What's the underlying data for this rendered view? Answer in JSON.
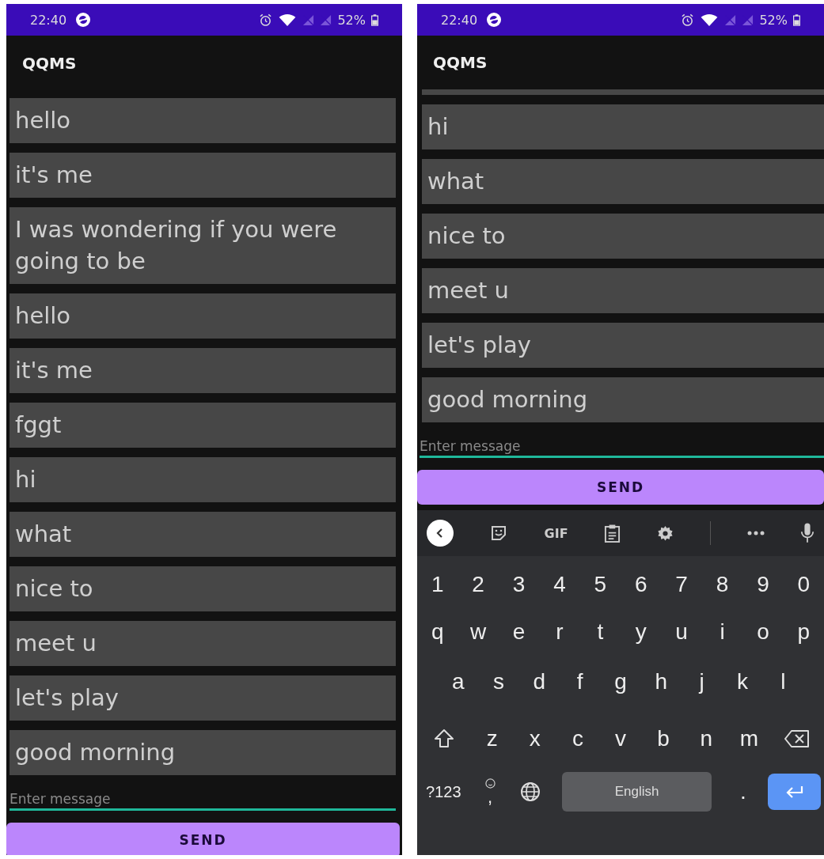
{
  "screens": [
    {
      "status_bar": {
        "time": "22:40",
        "battery": "52%"
      },
      "app_title": "QQMS",
      "messages": [
        {
          "text": "hello"
        },
        {
          "text": "it's me"
        },
        {
          "text": "I was wondering if you were going to be"
        },
        {
          "text": "hello"
        },
        {
          "text": "it's me"
        },
        {
          "text": "fggt"
        },
        {
          "text": "hi"
        },
        {
          "text": "what"
        },
        {
          "text": "nice to"
        },
        {
          "text": "meet u"
        },
        {
          "text": "let's play"
        },
        {
          "text": "good morning"
        }
      ],
      "input": {
        "placeholder": "Enter message"
      },
      "send_button": "SEND"
    },
    {
      "status_bar": {
        "time": "22:40",
        "battery": "52%"
      },
      "app_title": "QQMS",
      "scrolled_bubble_above": true,
      "messages": [
        {
          "text": "hi"
        },
        {
          "text": "what"
        },
        {
          "text": "nice to"
        },
        {
          "text": "meet u"
        },
        {
          "text": "let's play"
        },
        {
          "text": "good morning"
        }
      ],
      "input": {
        "placeholder": "Enter message"
      },
      "send_button": "SEND",
      "keyboard": {
        "toolbar": [
          {
            "kind": "back"
          },
          {
            "kind": "sticker"
          },
          {
            "kind": "gif",
            "label": "GIF"
          },
          {
            "kind": "clipboard"
          },
          {
            "kind": "settings"
          },
          {
            "kind": "divider"
          },
          {
            "kind": "more"
          },
          {
            "kind": "mic"
          }
        ],
        "rows": [
          [
            {
              "kind": "char",
              "label": "1"
            },
            {
              "kind": "char",
              "label": "2"
            },
            {
              "kind": "char",
              "label": "3"
            },
            {
              "kind": "char",
              "label": "4"
            },
            {
              "kind": "char",
              "label": "5"
            },
            {
              "kind": "char",
              "label": "6"
            },
            {
              "kind": "char",
              "label": "7"
            },
            {
              "kind": "char",
              "label": "8"
            },
            {
              "kind": "char",
              "label": "9"
            },
            {
              "kind": "char",
              "label": "0"
            }
          ],
          [
            {
              "kind": "char",
              "label": "q"
            },
            {
              "kind": "char",
              "label": "w"
            },
            {
              "kind": "char",
              "label": "e"
            },
            {
              "kind": "char",
              "label": "r"
            },
            {
              "kind": "char",
              "label": "t"
            },
            {
              "kind": "char",
              "label": "y"
            },
            {
              "kind": "char",
              "label": "u"
            },
            {
              "kind": "char",
              "label": "i"
            },
            {
              "kind": "char",
              "label": "o"
            },
            {
              "kind": "char",
              "label": "p"
            }
          ],
          [
            {
              "kind": "char",
              "label": "a"
            },
            {
              "kind": "char",
              "label": "s"
            },
            {
              "kind": "char",
              "label": "d"
            },
            {
              "kind": "char",
              "label": "f"
            },
            {
              "kind": "char",
              "label": "g"
            },
            {
              "kind": "char",
              "label": "h"
            },
            {
              "kind": "char",
              "label": "j"
            },
            {
              "kind": "char",
              "label": "k"
            },
            {
              "kind": "char",
              "label": "l"
            }
          ],
          [
            {
              "kind": "shift"
            },
            {
              "kind": "char",
              "label": "z"
            },
            {
              "kind": "char",
              "label": "x"
            },
            {
              "kind": "char",
              "label": "c"
            },
            {
              "kind": "char",
              "label": "v"
            },
            {
              "kind": "char",
              "label": "b"
            },
            {
              "kind": "char",
              "label": "n"
            },
            {
              "kind": "char",
              "label": "m"
            },
            {
              "kind": "backspace"
            }
          ],
          [
            {
              "kind": "symbols",
              "label": "?123"
            },
            {
              "kind": "emoji-comma",
              "label": ","
            },
            {
              "kind": "globe"
            },
            {
              "kind": "space",
              "label": "English"
            },
            {
              "kind": "char",
              "label": "."
            },
            {
              "kind": "enter"
            }
          ]
        ]
      }
    }
  ]
}
